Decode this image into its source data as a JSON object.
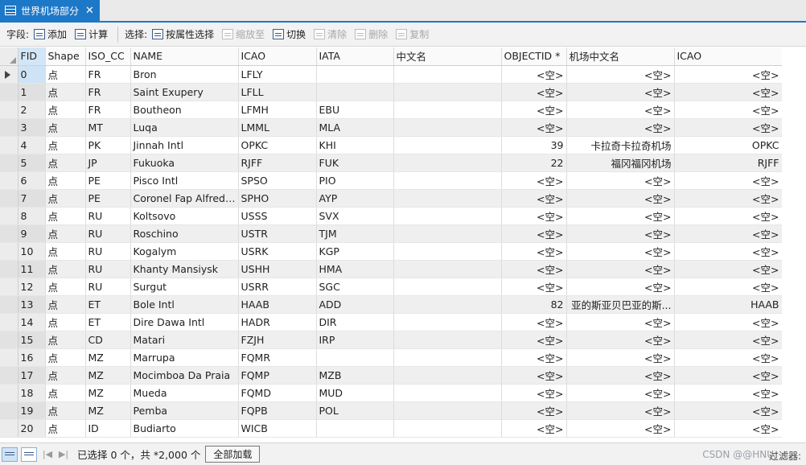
{
  "tab": {
    "title": "世界机场部分",
    "close": "✕"
  },
  "toolbar": {
    "fields_label": "字段:",
    "add": "添加",
    "calculate": "计算",
    "selection_label": "选择:",
    "select_by_attr": "按属性选择",
    "zoom_to": "缩放至",
    "switch": "切换",
    "clear": "清除",
    "delete": "删除",
    "copy": "复制"
  },
  "columns": [
    "FID",
    "Shape",
    "ISO_CC",
    "NAME",
    "ICAO",
    "IATA",
    "中文名",
    "OBJECTID *",
    "机场中文名",
    "ICAO"
  ],
  "rows": [
    [
      "0",
      "点",
      "FR",
      "Bron",
      "LFLY",
      "",
      "",
      "<空>",
      "<空>",
      "<空>"
    ],
    [
      "1",
      "点",
      "FR",
      "Saint Exupery",
      "LFLL",
      "",
      "",
      "<空>",
      "<空>",
      "<空>"
    ],
    [
      "2",
      "点",
      "FR",
      "Boutheon",
      "LFMH",
      "EBU",
      "",
      "<空>",
      "<空>",
      "<空>"
    ],
    [
      "3",
      "点",
      "MT",
      "Luqa",
      "LMML",
      "MLA",
      "",
      "<空>",
      "<空>",
      "<空>"
    ],
    [
      "4",
      "点",
      "PK",
      "Jinnah Intl",
      "OPKC",
      "KHI",
      "",
      "39",
      "卡拉奇卡拉奇机场",
      "OPKC"
    ],
    [
      "5",
      "点",
      "JP",
      "Fukuoka",
      "RJFF",
      "FUK",
      "",
      "22",
      "福冈福冈机场",
      "RJFF"
    ],
    [
      "6",
      "点",
      "PE",
      "Pisco Intl",
      "SPSO",
      "PIO",
      "",
      "<空>",
      "<空>",
      "<空>"
    ],
    [
      "7",
      "点",
      "PE",
      "Coronel Fap Alfredo...",
      "SPHO",
      "AYP",
      "",
      "<空>",
      "<空>",
      "<空>"
    ],
    [
      "8",
      "点",
      "RU",
      "Koltsovo",
      "USSS",
      "SVX",
      "",
      "<空>",
      "<空>",
      "<空>"
    ],
    [
      "9",
      "点",
      "RU",
      "Roschino",
      "USTR",
      "TJM",
      "",
      "<空>",
      "<空>",
      "<空>"
    ],
    [
      "10",
      "点",
      "RU",
      "Kogalym",
      "USRK",
      "KGP",
      "",
      "<空>",
      "<空>",
      "<空>"
    ],
    [
      "11",
      "点",
      "RU",
      "Khanty Mansiysk",
      "USHH",
      "HMA",
      "",
      "<空>",
      "<空>",
      "<空>"
    ],
    [
      "12",
      "点",
      "RU",
      "Surgut",
      "USRR",
      "SGC",
      "",
      "<空>",
      "<空>",
      "<空>"
    ],
    [
      "13",
      "点",
      "ET",
      "Bole Intl",
      "HAAB",
      "ADD",
      "",
      "82",
      "亚的斯亚贝巴亚的斯...",
      "HAAB"
    ],
    [
      "14",
      "点",
      "ET",
      "Dire Dawa Intl",
      "HADR",
      "DIR",
      "",
      "<空>",
      "<空>",
      "<空>"
    ],
    [
      "15",
      "点",
      "CD",
      "Matari",
      "FZJH",
      "IRP",
      "",
      "<空>",
      "<空>",
      "<空>"
    ],
    [
      "16",
      "点",
      "MZ",
      "Marrupa",
      "FQMR",
      "",
      "",
      "<空>",
      "<空>",
      "<空>"
    ],
    [
      "17",
      "点",
      "MZ",
      "Mocimboa Da Praia",
      "FQMP",
      "MZB",
      "",
      "<空>",
      "<空>",
      "<空>"
    ],
    [
      "18",
      "点",
      "MZ",
      "Mueda",
      "FQMD",
      "MUD",
      "",
      "<空>",
      "<空>",
      "<空>"
    ],
    [
      "19",
      "点",
      "MZ",
      "Pemba",
      "FQPB",
      "POL",
      "",
      "<空>",
      "<空>",
      "<空>"
    ],
    [
      "20",
      "点",
      "ID",
      "Budiarto",
      "WICB",
      "",
      "",
      "<空>",
      "<空>",
      "<空>"
    ]
  ],
  "status": {
    "selected": "已选择 0 个，共 *2,000 个",
    "load_all": "全部加载",
    "filter": "过滤器:",
    "watermark": "CSDN @@HNU"
  }
}
